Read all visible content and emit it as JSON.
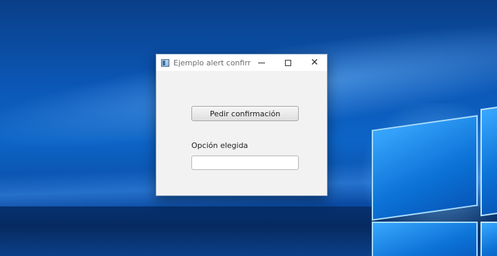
{
  "window": {
    "title": "Ejemplo alert confirm...",
    "controls": {
      "minimize": "minimize-icon",
      "maximize": "maximize-icon",
      "close": "close-icon"
    }
  },
  "content": {
    "button_label": "Pedir confirmación",
    "option_label": "Opción elegida",
    "option_value": ""
  },
  "colors": {
    "desktop": "#0b58b8",
    "window_bg": "#f2f2f2",
    "titlebar_bg": "#ffffff"
  }
}
